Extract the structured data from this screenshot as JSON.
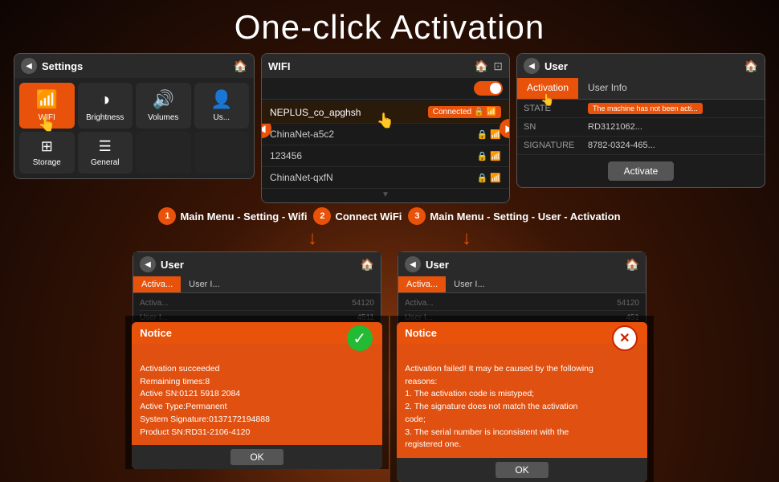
{
  "page": {
    "title": "One-click Activation"
  },
  "settings_panel": {
    "title": "Settings",
    "tiles": [
      {
        "id": "wifi",
        "label": "WIFI",
        "active": true,
        "icon": "📶"
      },
      {
        "id": "brightness",
        "label": "Brightness",
        "active": false,
        "icon": "◑"
      },
      {
        "id": "volumes",
        "label": "Volumes",
        "active": false,
        "icon": "🔊"
      },
      {
        "id": "user",
        "label": "Us...",
        "active": false,
        "icon": "👤"
      },
      {
        "id": "storage",
        "label": "Storage",
        "active": false,
        "icon": "▦"
      },
      {
        "id": "general",
        "label": "General",
        "active": false,
        "icon": "≡"
      }
    ]
  },
  "wifi_panel": {
    "title": "WIFI",
    "networks": [
      {
        "name": "NEPLUS_co_apghsh",
        "connected": true,
        "locked": true
      },
      {
        "name": "ChinaNet-a5c2",
        "connected": false,
        "locked": true
      },
      {
        "name": "123456",
        "connected": false,
        "locked": true
      },
      {
        "name": "ChinaNet-qxfN",
        "connected": false,
        "locked": true
      }
    ],
    "connected_label": "Connected"
  },
  "user_panel": {
    "title": "User",
    "tabs": [
      "Activation",
      "User Info"
    ],
    "active_tab": "Activation",
    "fields": [
      {
        "name": "STATE",
        "value": "The machine has not been acti..."
      },
      {
        "name": "SN",
        "value": "RD3121062..."
      },
      {
        "name": "SIGNATURE",
        "value": "8782-0324-465..."
      }
    ],
    "activate_button": "Activate"
  },
  "steps": [
    {
      "num": "1",
      "text": "Main Menu - Setting - Wifi"
    },
    {
      "num": "2",
      "text": "Connect WiFi"
    },
    {
      "num": "3",
      "text": "Main Menu - Setting - User - Activation"
    }
  ],
  "success_panel": {
    "title": "User",
    "tabs": [
      "Activa...",
      "User I..."
    ],
    "notice_title": "Notice",
    "notice_body": "Activation succeeded\nRemaining times:8\nActive SN:0121 5918 2084\nActive Type:Permanent\nSystem Signature:0137172194888\nProduct SN:RD31-2106-4120",
    "ok_label": "OK",
    "faded_rows": [
      {
        "label": "Activa...",
        "value": "54120"
      },
      {
        "label": "User I...",
        "value": "4511"
      }
    ]
  },
  "fail_panel": {
    "title": "User",
    "tabs": [
      "Activa...",
      "User I..."
    ],
    "notice_title": "Notice",
    "notice_body": "Activation failed! It may be caused by the following\nreasons:\n  1. The activation code is mistyped;\n  2. The signature does not match the activation\ncode;\n  3. The serial number is inconsistent with the\nregistered one.",
    "ok_label": "OK",
    "faded_rows": [
      {
        "label": "Activa...",
        "value": "54120"
      },
      {
        "label": "User I...",
        "value": "451"
      }
    ]
  }
}
